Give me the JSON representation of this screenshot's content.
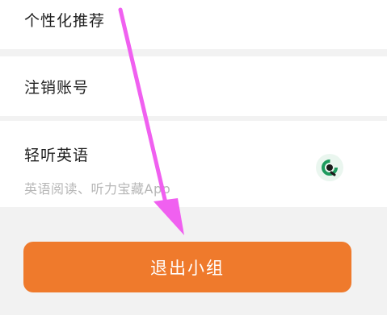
{
  "settings": {
    "items": [
      {
        "label": "个性化推荐"
      },
      {
        "label": "注销账号"
      }
    ],
    "app_promo": {
      "title": "轻听英语",
      "subtitle": "英语阅读、听力宝藏App",
      "logo_icon": "qingting-app-logo-icon",
      "logo_color": "#2bb673"
    }
  },
  "exit_button": {
    "label": "退出小组",
    "color": "#ef7a2c"
  },
  "annotation": {
    "icon": "pointer-arrow-icon",
    "color": "#f060f0"
  }
}
